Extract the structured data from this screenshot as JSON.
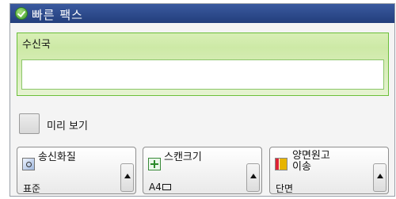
{
  "window": {
    "title": "빠른 팩스"
  },
  "recipient": {
    "label": "수신국",
    "value": ""
  },
  "preview": {
    "label": "미리 보기",
    "checked": false
  },
  "buttons": {
    "quality": {
      "label": "송신화질",
      "value": "표준",
      "icon": "document-quality-icon"
    },
    "scan_size": {
      "label": "스캔크기",
      "value": "A4",
      "icon": "scan-size-icon"
    },
    "duplex": {
      "label_line1": "양면원고",
      "label_line2": "이송",
      "value": "단면",
      "icon": "duplex-icon"
    }
  }
}
